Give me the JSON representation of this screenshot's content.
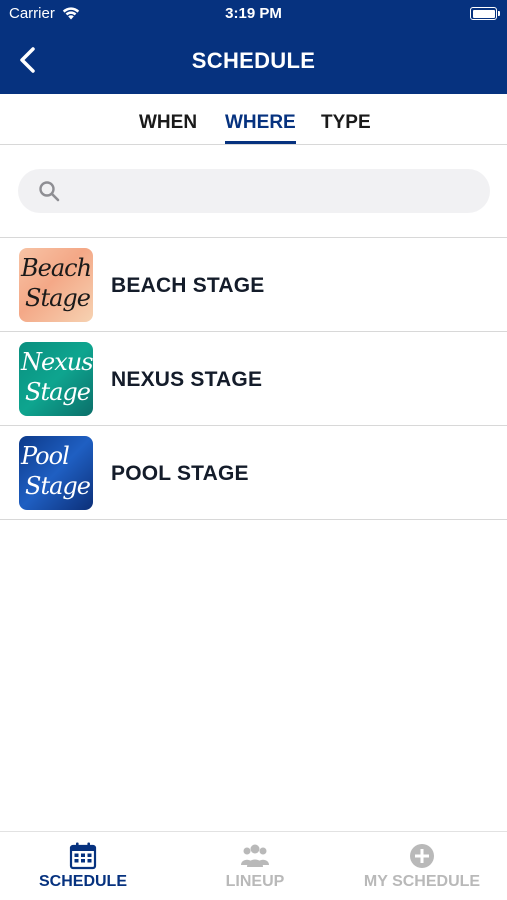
{
  "status_bar": {
    "carrier": "Carrier",
    "time": "3:19 PM"
  },
  "header": {
    "title": "SCHEDULE",
    "back_icon": "chevron-left-icon"
  },
  "tabs": [
    {
      "label": "WHEN",
      "active": false
    },
    {
      "label": "WHERE",
      "active": true
    },
    {
      "label": "TYPE",
      "active": false
    }
  ],
  "search": {
    "placeholder": "",
    "value": "",
    "icon": "search-icon"
  },
  "stages": [
    {
      "label": "BEACH STAGE",
      "thumb_line1": "Beach",
      "thumb_line2": "Stage"
    },
    {
      "label": "NEXUS STAGE",
      "thumb_line1": "Nexus",
      "thumb_line2": "Stage"
    },
    {
      "label": "POOL STAGE",
      "thumb_line1": "Pool",
      "thumb_line2": "Stage"
    }
  ],
  "bottom_nav": [
    {
      "label": "SCHEDULE",
      "icon": "calendar-icon",
      "active": true
    },
    {
      "label": "LINEUP",
      "icon": "group-icon",
      "active": false
    },
    {
      "label": "MY SCHEDULE",
      "icon": "plus-circle-icon",
      "active": false
    }
  ],
  "colors": {
    "brand": "#06327f",
    "inactive": "#b9b9b9"
  }
}
